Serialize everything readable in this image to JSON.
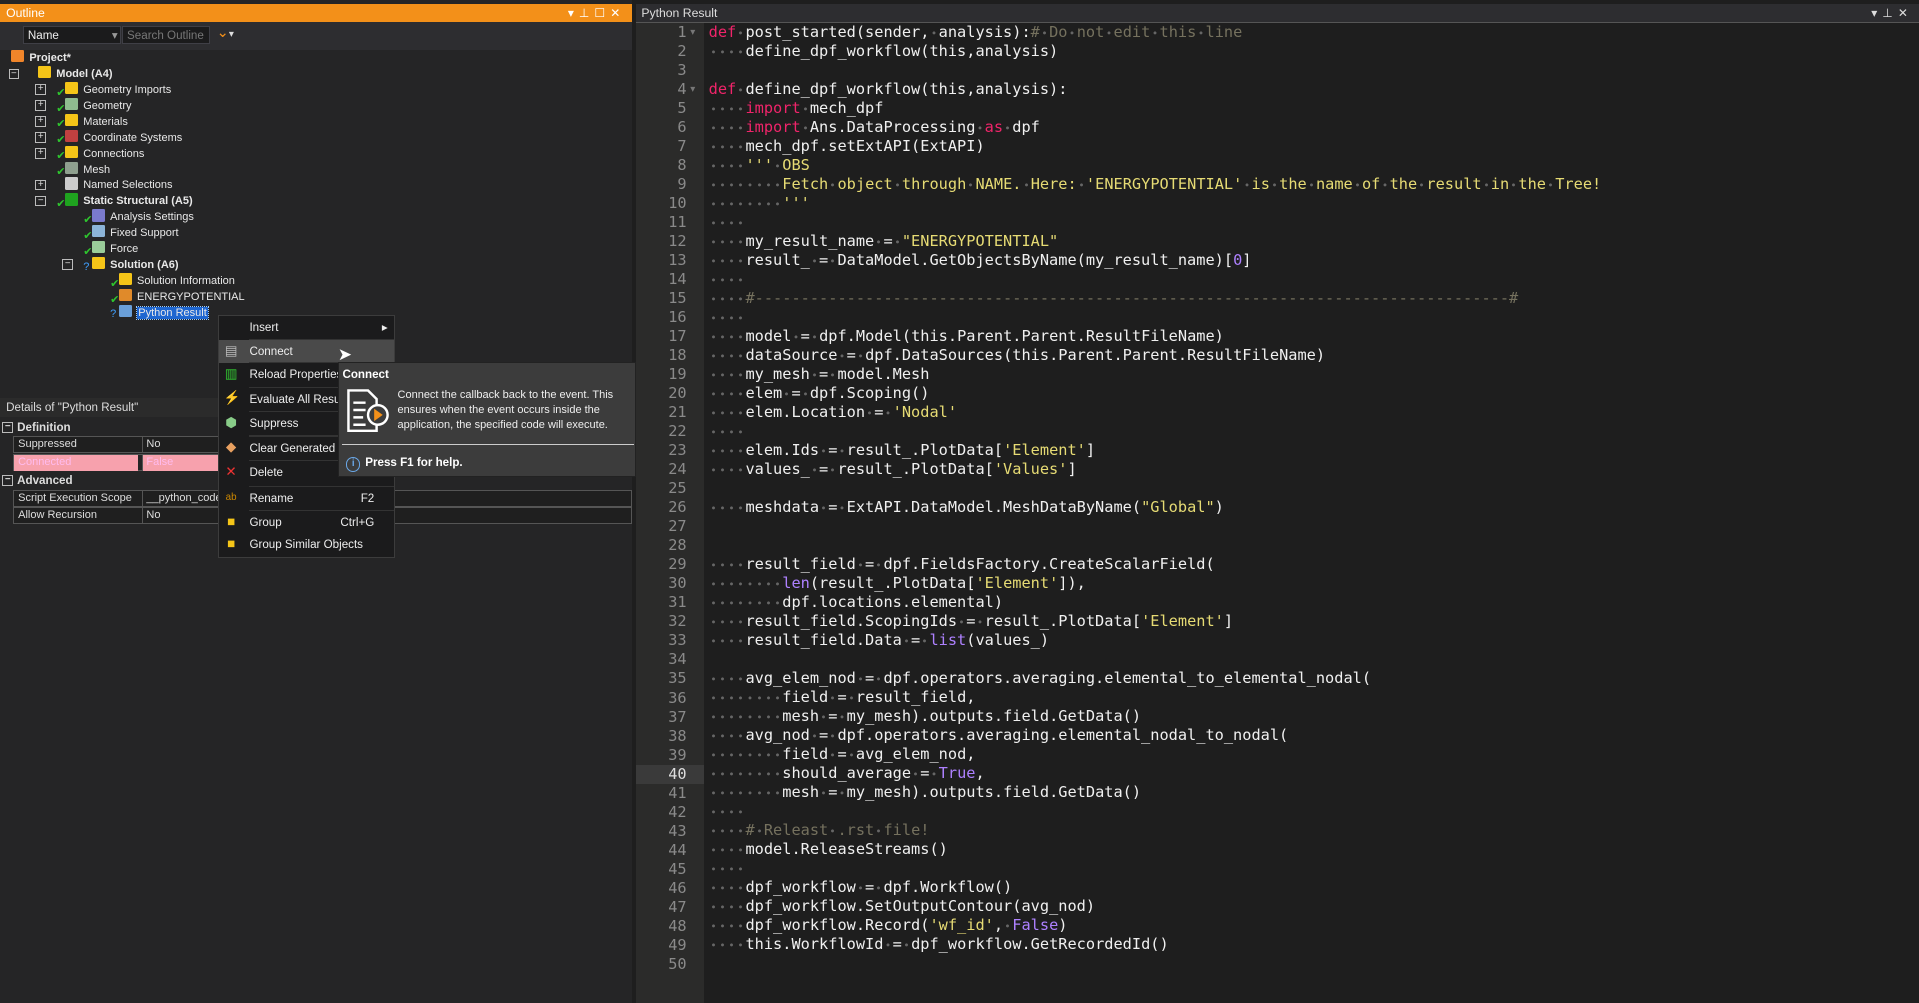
{
  "outline": {
    "title": "Outline",
    "name_filter": "Name",
    "search_placeholder": "Search Outline",
    "tree": [
      {
        "label": "Project*",
        "bold": true,
        "level": 0,
        "icon": "project-icon",
        "color": "#f0852a"
      },
      {
        "label": "Model (A4)",
        "bold": true,
        "level": 1,
        "icon": "model-icon",
        "color": "#f5c518",
        "expander": "minus"
      },
      {
        "label": "Geometry Imports",
        "level": 2,
        "icon": "geometry-imports-icon",
        "color": "#f5c518",
        "expander": "plus",
        "status": "check"
      },
      {
        "label": "Geometry",
        "level": 2,
        "icon": "geometry-icon",
        "color": "#8fbc8f",
        "expander": "plus",
        "status": "check"
      },
      {
        "label": "Materials",
        "level": 2,
        "icon": "materials-icon",
        "color": "#f5c518",
        "expander": "plus",
        "status": "check"
      },
      {
        "label": "Coordinate Systems",
        "level": 2,
        "icon": "coordinate-systems-icon",
        "color": "#c04040",
        "expander": "plus",
        "status": "check"
      },
      {
        "label": "Connections",
        "level": 2,
        "icon": "connections-icon",
        "color": "#f5c518",
        "expander": "plus",
        "status": "check"
      },
      {
        "label": "Mesh",
        "level": 2,
        "icon": "mesh-icon",
        "color": "#8fa08f",
        "status": "check"
      },
      {
        "label": "Named Selections",
        "level": 2,
        "icon": "named-selections-icon",
        "color": "#cccccc",
        "expander": "plus"
      },
      {
        "label": "Static Structural (A5)",
        "bold": true,
        "level": 2,
        "icon": "static-structural-icon",
        "color": "#1fa31f",
        "expander": "minus",
        "status": "check"
      },
      {
        "label": "Analysis Settings",
        "level": 3,
        "icon": "analysis-settings-icon",
        "color": "#7a7acc",
        "status": "check"
      },
      {
        "label": "Fixed Support",
        "level": 3,
        "icon": "fixed-support-icon",
        "color": "#8cb4d8",
        "status": "check"
      },
      {
        "label": "Force",
        "level": 3,
        "icon": "force-icon",
        "color": "#9acd9a",
        "status": "check"
      },
      {
        "label": "Solution (A6)",
        "bold": true,
        "level": 3,
        "icon": "solution-icon",
        "color": "#f5c518",
        "expander": "minus",
        "status": "question"
      },
      {
        "label": "Solution Information",
        "level": 4,
        "icon": "solution-information-icon",
        "color": "#f5c518",
        "status": "check"
      },
      {
        "label": "ENERGYPOTENTIAL",
        "level": 4,
        "icon": "user-result-icon",
        "color": "#e08a2a",
        "status": "check"
      },
      {
        "label": "Python Result",
        "level": 4,
        "icon": "python-result-icon",
        "color": "#6a9fd8",
        "status": "question",
        "selected": true
      }
    ]
  },
  "details": {
    "title": "Details of \"Python Result\"",
    "groups": [
      {
        "name": "Definition",
        "rows": [
          {
            "key": "Suppressed",
            "value": "No"
          },
          {
            "key": "Connected",
            "value": "False",
            "highlight": "#f7a1ad"
          }
        ]
      },
      {
        "name": "Advanced",
        "rows": [
          {
            "key": "Script Execution Scope",
            "value": "__python_code"
          },
          {
            "key": "Allow Recursion",
            "value": "No"
          }
        ]
      }
    ]
  },
  "context_menu": {
    "items": [
      {
        "label": "Insert",
        "icon": "",
        "submenu": true
      },
      {
        "label": "Connect",
        "icon": "connect-icon",
        "hover": true
      },
      {
        "label": "Reload Properties",
        "icon": "reload-properties-icon"
      },
      {
        "label": "Evaluate All Results",
        "icon": "evaluate-lightning-icon"
      },
      {
        "label": "Suppress",
        "icon": "suppress-icon"
      },
      {
        "label": "Clear Generated Data",
        "icon": "eraser-icon"
      },
      {
        "label": "Delete",
        "icon": "delete-x-icon"
      },
      {
        "label": "Rename",
        "icon": "rename-icon",
        "shortcut": "F2"
      },
      {
        "label": "Group",
        "icon": "folder-icon",
        "shortcut": "Ctrl+G"
      },
      {
        "label": "Group Similar Objects",
        "icon": "folder-icon"
      }
    ]
  },
  "tooltip": {
    "title": "Connect",
    "description": "Connect the callback back to the event. This ensures when the event occurs inside the application, the specified code will execute.",
    "help": "Press F1 for help."
  },
  "editor": {
    "title": "Python Result",
    "current_line": 40,
    "lines": [
      "def post_started(sender, analysis):# Do not edit this line",
      "    define_dpf_workflow(this,analysis)",
      "",
      "def define_dpf_workflow(this,analysis):",
      "    import mech_dpf",
      "    import Ans.DataProcessing as dpf",
      "    mech_dpf.setExtAPI(ExtAPI)",
      "    ''' OBS",
      "        Fetch object through NAME. Here: 'ENERGYPOTENTIAL' is the name of the result in the Tree!",
      "        '''",
      "    ",
      "    my_result_name = \"ENERGYPOTENTIAL\"",
      "    result_ = DataModel.GetObjectsByName(my_result_name)[0]",
      "    ",
      "    #----------------------------------------------------------------------------------#",
      "    ",
      "    model = dpf.Model(this.Parent.Parent.ResultFileName)",
      "    dataSource = dpf.DataSources(this.Parent.Parent.ResultFileName)",
      "    my_mesh = model.Mesh",
      "    elem = dpf.Scoping()",
      "    elem.Location = 'Nodal'",
      "    ",
      "    elem.Ids = result_.PlotData['Element']",
      "    values_ = result_.PlotData['Values']",
      "",
      "    meshdata = ExtAPI.DataModel.MeshDataByName(\"Global\")",
      "",
      "",
      "    result_field = dpf.FieldsFactory.CreateScalarField(",
      "        len(result_.PlotData['Element']),",
      "        dpf.locations.elemental)",
      "    result_field.ScopingIds = result_.PlotData['Element']",
      "    result_field.Data = list(values_)",
      "",
      "    avg_elem_nod = dpf.operators.averaging.elemental_to_elemental_nodal(",
      "        field = result_field,",
      "        mesh = my_mesh).outputs.field.GetData()",
      "    avg_nod = dpf.operators.averaging.elemental_nodal_to_nodal(",
      "        field = avg_elem_nod,",
      "        should_average = True,",
      "        mesh = my_mesh).outputs.field.GetData()",
      "    ",
      "    # Releast .rst file!",
      "    model.ReleaseStreams()",
      "    ",
      "    dpf_workflow = dpf.Workflow()",
      "    dpf_workflow.SetOutputContour(avg_nod)",
      "    dpf_workflow.Record('wf_id', False)",
      "    this.WorkflowId = dpf_workflow.GetRecordedId()",
      ""
    ]
  },
  "colors": {
    "accent": "#f39019",
    "selection": "#1e66d0",
    "keyword": "#f0246a",
    "string": "#e6db74"
  }
}
